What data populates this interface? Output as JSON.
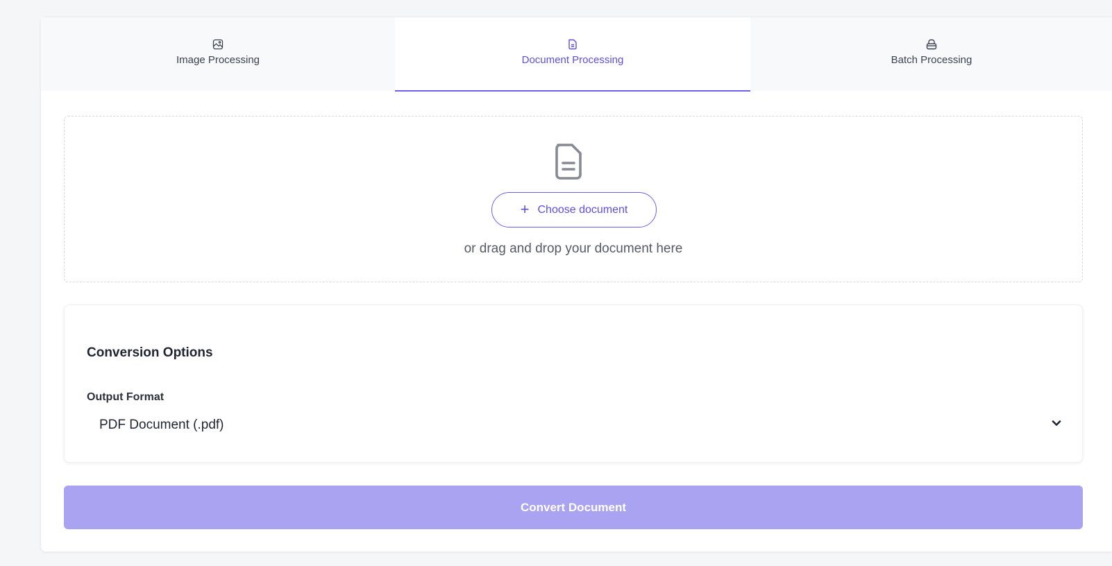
{
  "tabs": [
    {
      "label": "Image Processing",
      "icon": "image-icon",
      "active": false
    },
    {
      "label": "Document Processing",
      "icon": "document-icon",
      "active": true
    },
    {
      "label": "Batch Processing",
      "icon": "layers-icon",
      "active": false
    }
  ],
  "upload": {
    "icon": "document-icon",
    "button_label": "Choose document",
    "button_icon": "plus-icon",
    "hint": "or drag and drop your document here"
  },
  "options": {
    "title": "Conversion Options",
    "output_format_label": "Output Format",
    "output_format_value": "PDF Document (.pdf)"
  },
  "convert_button": {
    "label": "Convert Document"
  },
  "colors": {
    "accent": "#5b4fe6",
    "convert_disabled": "#a9a3f1",
    "background": "#f5f6f8"
  }
}
